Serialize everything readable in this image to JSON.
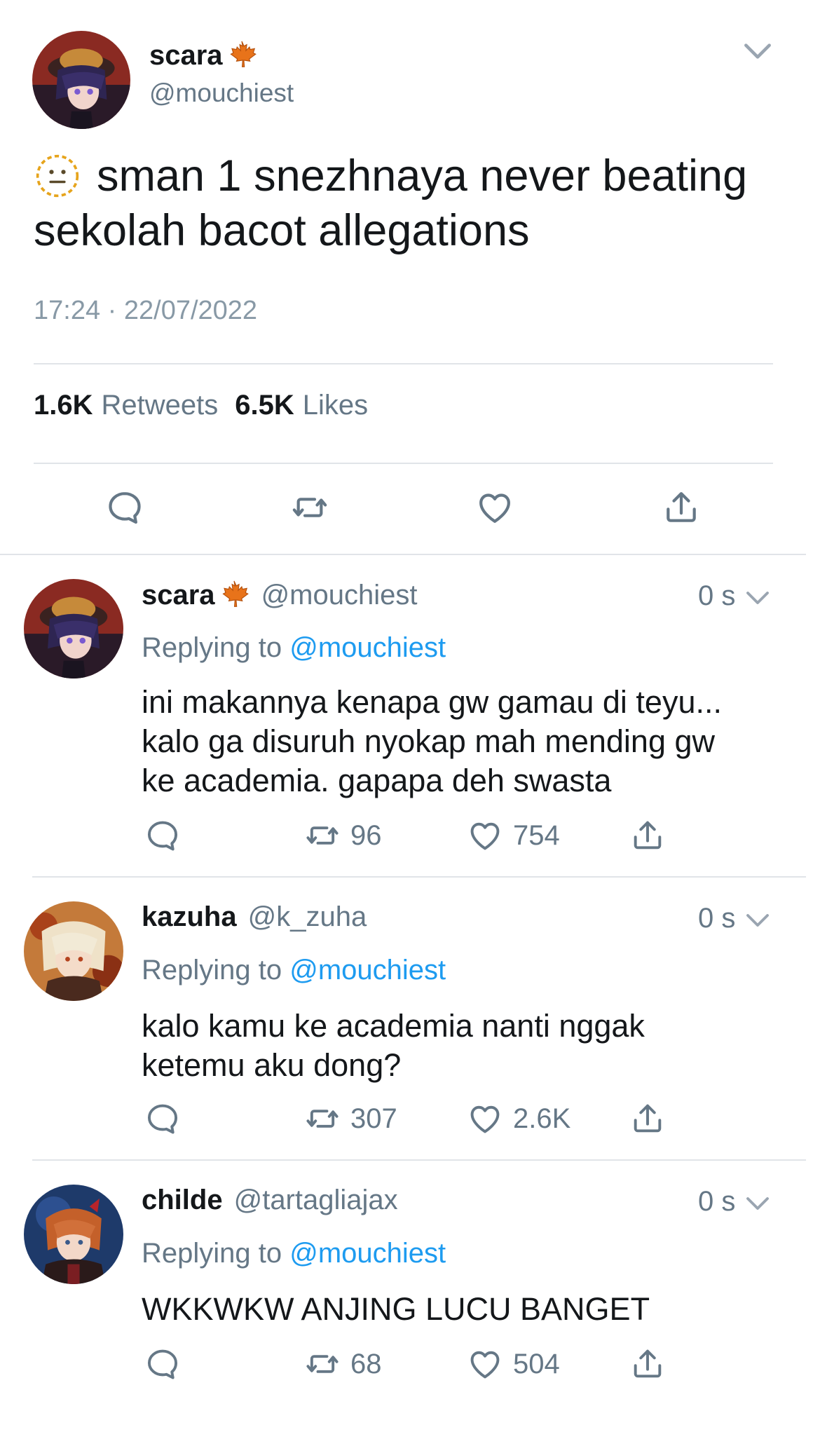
{
  "main_tweet": {
    "name": "scara",
    "handle": "@mouchiest",
    "text_line1": "sman 1 snezhnaya never beating",
    "text_line2": "sekolah bacot allegations",
    "timestamp": "17:24 · 22/07/2022",
    "retweets_count": "1.6K",
    "retweets_label": "Retweets",
    "likes_count": "6.5K",
    "likes_label": "Likes"
  },
  "replies": [
    {
      "name": "scara",
      "handle": "@mouchiest",
      "time": "0 s",
      "replying_prefix": "Replying to",
      "replying_handle": "@mouchiest",
      "lines": [
        "ini makannya kenapa gw gamau di teyu...",
        "kalo ga disuruh nyokap mah mending gw",
        "ke academia. gapapa deh swasta"
      ],
      "retweets": "96",
      "likes": "754"
    },
    {
      "name": "kazuha",
      "handle": "@k_zuha",
      "time": "0 s",
      "replying_prefix": "Replying to",
      "replying_handle": "@mouchiest",
      "lines": [
        "kalo kamu ke academia nanti nggak",
        "ketemu aku dong?"
      ],
      "retweets": "307",
      "likes": "2.6K"
    },
    {
      "name": "childe",
      "handle": "@tartagliajax",
      "time": "0 s",
      "replying_prefix": "Replying to",
      "replying_handle": "@mouchiest",
      "lines": [
        "WKKWKW ANJING LUCU BANGET"
      ],
      "retweets": "68",
      "likes": "504"
    }
  ],
  "colors": {
    "link_blue": "#1d9bf0",
    "secondary_gray": "#657786",
    "maple_orange": "#e8731a"
  },
  "icons": [
    "maple-leaf-icon",
    "neutral-face-emoji-icon",
    "reply-icon",
    "retweet-icon",
    "like-icon",
    "share-icon",
    "chevron-down-icon"
  ]
}
